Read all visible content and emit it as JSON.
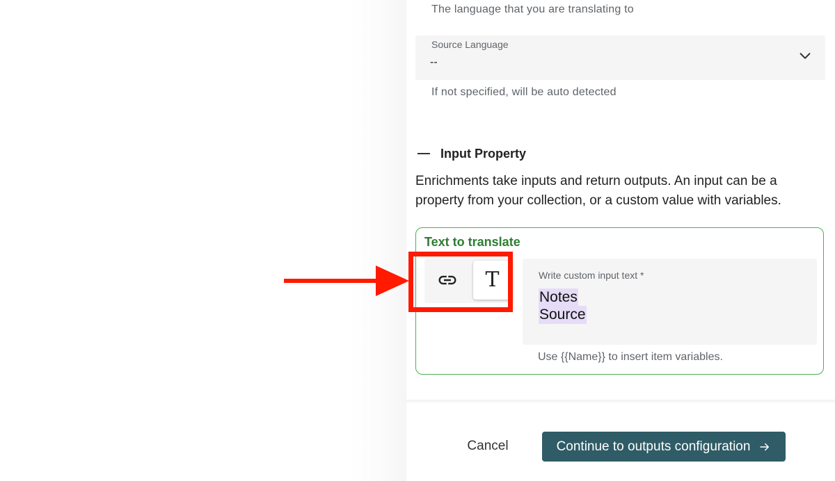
{
  "target_language": {
    "helper_text": "The language that you are translating to"
  },
  "source_language": {
    "label": "Source Language",
    "value": "--",
    "helper_text": "If not specified, will be auto detected",
    "chevron_icon": "chevron-down-icon"
  },
  "input_property": {
    "section_title": "Input Property",
    "collapse_icon": "minus-icon",
    "description": "Enrichments take inputs and return outputs. An input can be a property from your collection, or a custom value with variables.",
    "card": {
      "title": "Text to translate",
      "mode_toggle": {
        "link_icon": "link-icon",
        "text_glyph": "T"
      },
      "custom_input": {
        "label": "Write custom input text *",
        "variables": [
          "Notes",
          "Source"
        ],
        "helper_text": "Use {{Name}} to insert item variables."
      }
    }
  },
  "footer": {
    "cancel_label": "Cancel",
    "continue_label": "Continue to outputs configuration",
    "continue_icon": "arrow-right-icon"
  },
  "colors": {
    "accent": "#2f5c66",
    "card_border": "#4caf50",
    "card_title": "#2e7d32",
    "variable_chip": "#e6dcf7",
    "annotation": "#ff1a00"
  }
}
